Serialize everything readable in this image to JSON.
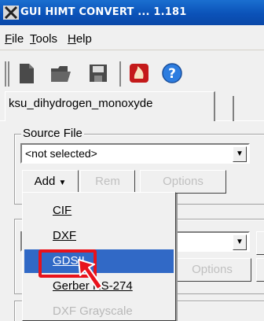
{
  "window": {
    "title": "GUI HIMT CONVERT ... 1.181",
    "icon": "x-logo-icon"
  },
  "menubar": {
    "items": [
      {
        "label": "File",
        "underline": "F"
      },
      {
        "label": "Tools",
        "underline": "T"
      },
      {
        "label": "Help",
        "underline": "H"
      }
    ]
  },
  "toolbar": {
    "buttons": [
      "new-document-icon",
      "open-folder-icon",
      "save-disk-icon",
      "fire-logo-icon",
      "help-question-icon"
    ]
  },
  "tabs": [
    {
      "label": "ksu_dihydrogen_monoxyde",
      "active": true
    }
  ],
  "source_file": {
    "legend": "Source File",
    "selected": "<not selected>",
    "add_label": "Add",
    "rem_label": "Rem",
    "options_label": "Options"
  },
  "second_group": {
    "options_label": "Options"
  },
  "add_menu": {
    "items": [
      {
        "label": "CIF",
        "state": "normal"
      },
      {
        "label": "DXF",
        "state": "normal"
      },
      {
        "label": "GDSII",
        "state": "selected"
      },
      {
        "label": "Gerber RS-274",
        "state": "normal"
      },
      {
        "label": "DXF Grayscale",
        "state": "disabled"
      }
    ]
  },
  "colors": {
    "titlebar": "#0b52b8",
    "selection": "#3169c6",
    "highlight": "#e8121b"
  }
}
